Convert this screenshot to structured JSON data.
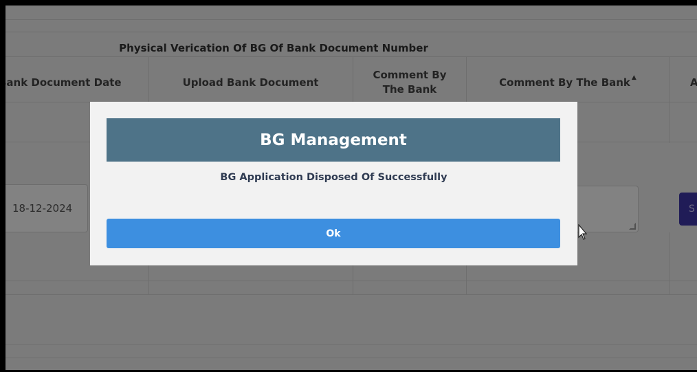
{
  "table": {
    "caption": "Physical Verication Of BG Of Bank Document Number",
    "columns": [
      "Bank Document Date",
      "Upload Bank Document",
      "Comment By The Bank",
      "Comment By The Bank",
      "A"
    ],
    "sort_indicator": "▲"
  },
  "form": {
    "date_value": "18-12-2024",
    "submit_label": "S"
  },
  "dialog": {
    "title": "BG Management",
    "message": "BG Application Disposed Of Successfully",
    "ok_label": "Ok"
  },
  "colors": {
    "dialog_header": "#4e7388",
    "ok_button": "#3d8fe0",
    "submit_button": "#3e36a8"
  },
  "icons": [
    "sort-ascending-icon",
    "mouse-cursor-icon",
    "resize-grip-icon"
  ]
}
